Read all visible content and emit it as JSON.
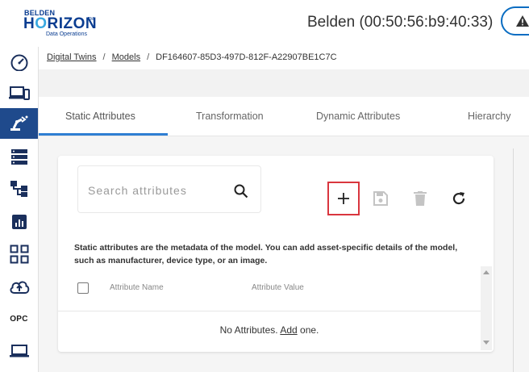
{
  "header": {
    "logo_brand_top": "BELDEN",
    "logo_brand_main": "HORIZON",
    "logo_tm": "TM",
    "logo_sub": "Data Operations",
    "device_title": "Belden (00:50:56:b9:40:33)",
    "alert_icon": "warning-icon"
  },
  "sidebar": {
    "items": [
      {
        "icon": "dashboard-gauge-icon",
        "active": false
      },
      {
        "icon": "devices-icon",
        "active": false
      },
      {
        "icon": "digital-twins-icon",
        "active": true
      },
      {
        "icon": "server-list-icon",
        "active": false
      },
      {
        "icon": "hierarchy-icon",
        "active": false
      },
      {
        "icon": "reports-chart-icon",
        "active": false
      },
      {
        "icon": "apps-grid-icon",
        "active": false
      },
      {
        "icon": "cloud-upload-icon",
        "active": false
      },
      {
        "label": "OPC",
        "active": false
      },
      {
        "icon": "laptop-icon",
        "active": false
      }
    ]
  },
  "breadcrumb": {
    "items": [
      "Digital Twins",
      "Models"
    ],
    "current": "DF164607-85D3-497D-812F-A22907BE1C7C",
    "separator": "/"
  },
  "tabs": [
    "Static Attributes",
    "Transformation",
    "Dynamic Attributes",
    "Hierarchy"
  ],
  "active_tab": 0,
  "search": {
    "placeholder": "Search attributes"
  },
  "toolbar": {
    "add_icon": "plus-icon",
    "save_icon": "save-icon",
    "delete_icon": "delete-icon",
    "refresh_icon": "refresh-icon"
  },
  "description": "Static attributes are the metadata of the model. You can add asset-specific details of the model, such as manufacturer, device type, or an image.",
  "table": {
    "columns": [
      "Attribute Name",
      "Attribute Value"
    ],
    "empty_prefix": "No Attributes. ",
    "empty_link": "Add",
    "empty_suffix": " one."
  },
  "colors": {
    "brand": "#0a3d91",
    "sidebar_active": "#1f4a8c",
    "tab_accent": "#2f7fd3",
    "highlight_border": "#d9363e"
  }
}
